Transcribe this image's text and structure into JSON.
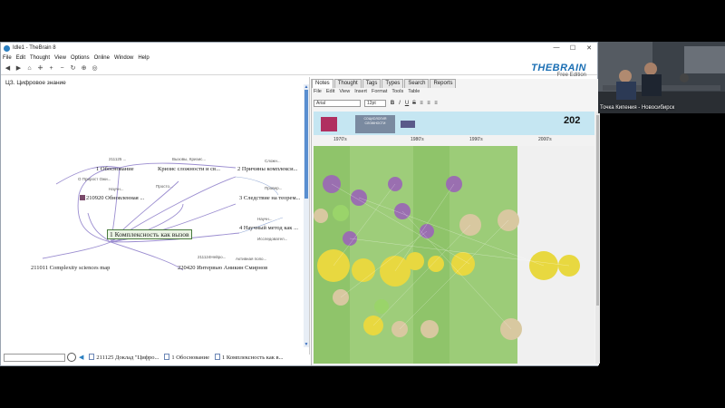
{
  "window": {
    "title": "Idle1 - TheBrain 8",
    "controls": [
      "—",
      "☐",
      "✕"
    ]
  },
  "menu": [
    "File",
    "Edit",
    "Thought",
    "View",
    "Options",
    "Online",
    "Window",
    "Help"
  ],
  "brand": {
    "name": "THEBRAIN",
    "edition": "Free Edition"
  },
  "plex": {
    "title": "ЦЗ. Цифровое знание",
    "active_thought": "1 Комплексность как вызов",
    "nodes": {
      "n_obosn": "1 Обоснование",
      "n_krizis": "Кризис сложности и св...",
      "n_prichiny": "2 Причины комплекси...",
      "n_210920": "210920 Обновленная ...",
      "n_sledstvie": "3 Следствие на теорем...",
      "n_nauch": "4 Научный метод как ...",
      "n_211011": "211011 Complexity sciences map",
      "n_220420": "220420 Интервью Аникин Смирнов",
      "s_211125": "211125 ...",
      "s_vyzovy": "Вызовы, Кризис...",
      "s_slozhn": "Сложн...",
      "s_prirost": "О Прирост Ожи...",
      "s_prosto": "Просто...",
      "s_nauchn": "Научн...",
      "s_prover": "Провер...",
      "s_nauch2": "Научн...",
      "s_issled": "Исследовател...",
      "s_211124": "211124Нейро...",
      "s_aktiv": "Активная попо..."
    }
  },
  "breadcrumbs": [
    "211125 Доклад \"Цифро...",
    "1 Обоснование",
    "1 Комплексность как в..."
  ],
  "notes": {
    "tabs": [
      "Notes",
      "Thought",
      "Tags",
      "Types",
      "Search",
      "Reports"
    ],
    "menu": [
      "File",
      "Edit",
      "View",
      "Insert",
      "Format",
      "Tools",
      "Table"
    ],
    "font": "Arial",
    "size": "12pt",
    "format_buttons": [
      "B",
      "I",
      "U",
      "S",
      "≡",
      "≡",
      "≡"
    ],
    "image": {
      "year": "202",
      "decades": [
        "1970's",
        "1980's",
        "1990's",
        "2000's"
      ],
      "badge": "СОЦИОЛОГИЯ СЛОЖНОСТИ"
    }
  },
  "webcam": {
    "label": "Точка Кипения - Новосибирск"
  },
  "colors": {
    "accent": "#1b6fb4",
    "active_node": "#4a7b3f",
    "map_green": "#8fc46a",
    "map_sky": "#c5e6f2"
  }
}
